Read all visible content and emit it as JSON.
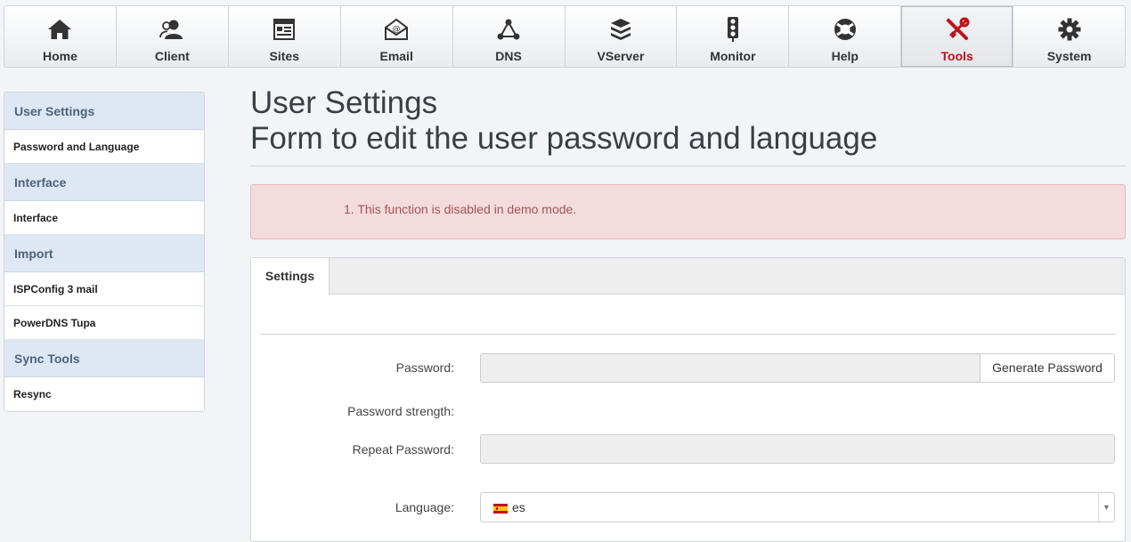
{
  "nav": [
    {
      "label": "Home",
      "icon": "home-icon"
    },
    {
      "label": "Client",
      "icon": "client-icon"
    },
    {
      "label": "Sites",
      "icon": "sites-icon"
    },
    {
      "label": "Email",
      "icon": "email-icon"
    },
    {
      "label": "DNS",
      "icon": "dns-icon"
    },
    {
      "label": "VServer",
      "icon": "vserver-icon"
    },
    {
      "label": "Monitor",
      "icon": "monitor-icon"
    },
    {
      "label": "Help",
      "icon": "help-icon"
    },
    {
      "label": "Tools",
      "icon": "tools-icon",
      "active": true
    },
    {
      "label": "System",
      "icon": "system-icon"
    }
  ],
  "sidebar": {
    "sections": [
      {
        "header": "User Settings",
        "links": [
          "Password and Language"
        ]
      },
      {
        "header": "Interface",
        "links": [
          "Interface"
        ]
      },
      {
        "header": "Import",
        "links": [
          "ISPConfig 3 mail",
          "PowerDNS Tupa"
        ]
      },
      {
        "header": "Sync Tools",
        "links": [
          "Resync"
        ]
      }
    ]
  },
  "page": {
    "title_line1": "User Settings",
    "title_line2": "Form to edit the user password and language"
  },
  "alert": {
    "message": "1. This function is disabled in demo mode."
  },
  "form": {
    "tab": "Settings",
    "password_label": "Password:",
    "generate_button": "Generate Password",
    "strength_label": "Password strength:",
    "repeat_label": "Repeat Password:",
    "language_label": "Language:",
    "language_value": "es"
  },
  "colors": {
    "accent_active": "#c0101a",
    "sidebar_header_bg": "#dde8f4",
    "alert_bg": "#f4dcdc"
  }
}
